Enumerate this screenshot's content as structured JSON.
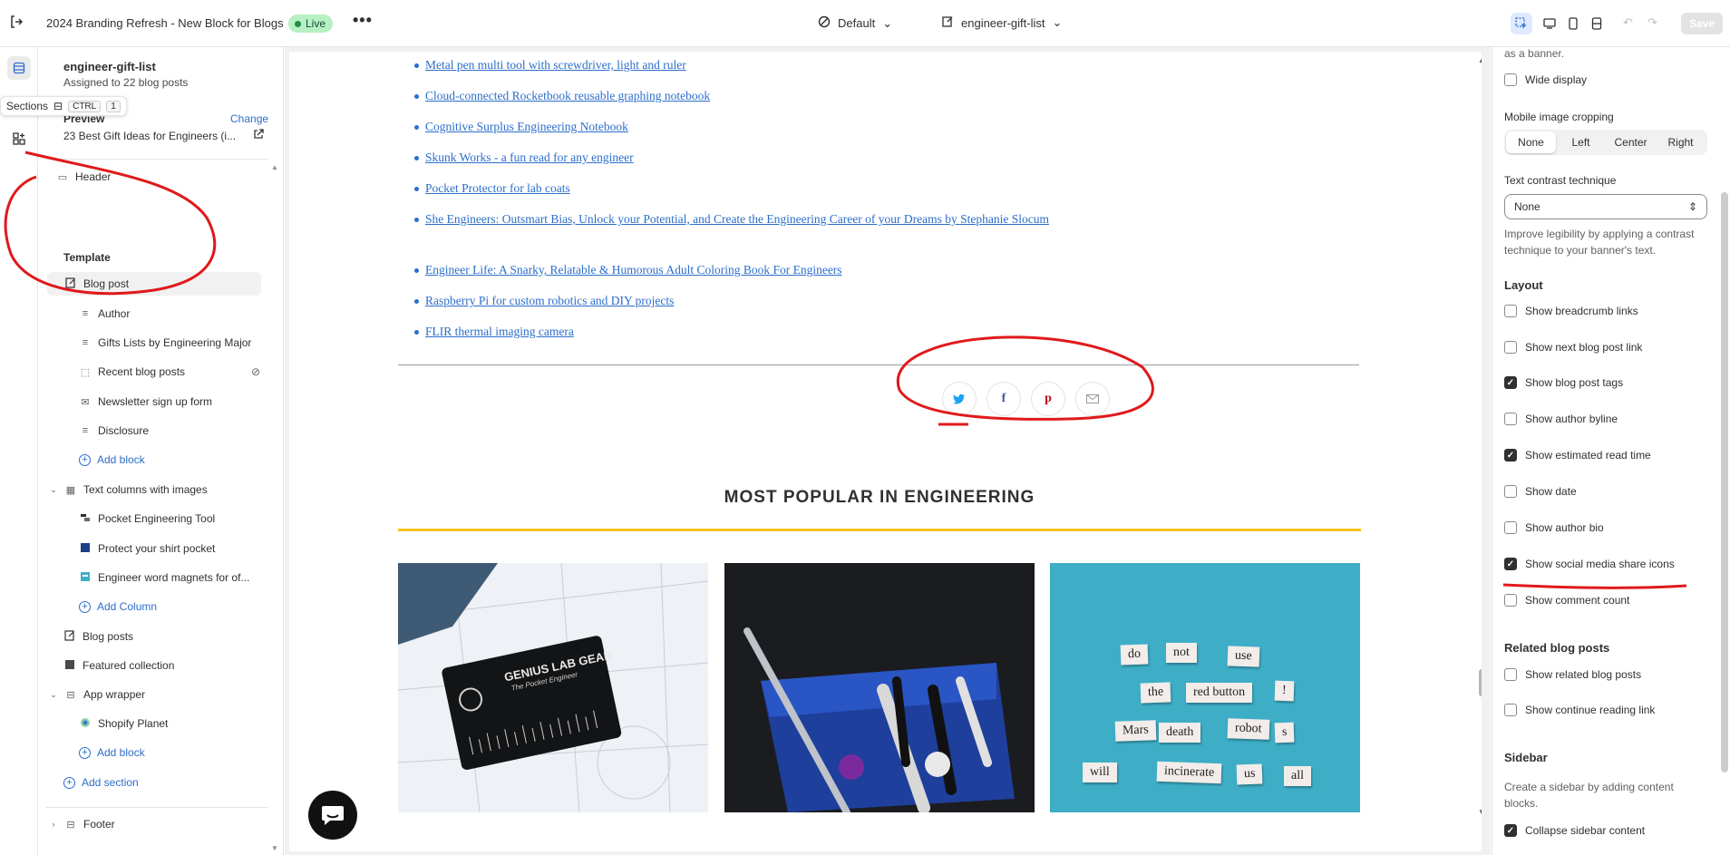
{
  "topbar": {
    "store_title": "2024 Branding Refresh - New Block for Blogs",
    "live_badge": "Live",
    "theme_label": "Default",
    "template_label": "engineer-gift-list",
    "save_label": "Save"
  },
  "rail": {
    "tooltip_label": "Sections",
    "tooltip_key_1": "CTRL",
    "tooltip_key_2": "1"
  },
  "left_panel": {
    "title": "engineer-gift-list",
    "subtitle": "Assigned to 22 blog posts",
    "preview_label": "Preview",
    "change_label": "Change",
    "preview_value": "23 Best Gift Ideas for Engineers (i...",
    "tree": {
      "header": "Header",
      "template_heading": "Template",
      "blog_post": "Blog post",
      "author": "Author",
      "gifts_lists": "Gifts Lists by Engineering Major",
      "recent_posts": "Recent blog posts",
      "newsletter": "Newsletter sign up form",
      "disclosure": "Disclosure",
      "add_block_1": "Add block",
      "text_columns": "Text columns with images",
      "pocket_tool": "Pocket Engineering Tool",
      "protect_shirt": "Protect your shirt pocket",
      "word_magnets": "Engineer word magnets for of...",
      "add_column": "Add Column",
      "blog_posts": "Blog posts",
      "featured": "Featured collection",
      "app_wrapper": "App wrapper",
      "shopify_planet": "Shopify Planet",
      "add_block_2": "Add block",
      "add_section": "Add section",
      "footer": "Footer"
    }
  },
  "canvas": {
    "links": [
      "Metal pen multi tool with screwdriver, light and ruler",
      "Cloud-connected Rocketbook reusable graphing notebook",
      "Cognitive Surplus Engineering Notebook",
      "Skunk Works - a fun read for any engineer",
      "Pocket Protector for lab coats",
      "She Engineers: Outsmart Bias, Unlock your Potential, and Create the Engineering Career of your Dreams by Stephanie Slocum",
      "Engineer Life: A Snarky, Relatable & Humorous Adult Coloring Book For Engineers",
      "Raspberry Pi for custom robotics and DIY projects",
      "FLIR thermal imaging camera"
    ],
    "popular_title": "MOST POPULAR IN ENGINEERING",
    "card1_brand": "GENIUS LAB GEAR",
    "card1_tagline": "The Pocket Engineer",
    "magnet_words": [
      "do",
      "not",
      "use",
      "the",
      "red button",
      "!",
      "Mars",
      "death",
      "robot",
      "s",
      "will",
      "incinerate",
      "us",
      "all"
    ]
  },
  "right_panel": {
    "banner_tail": "as a banner.",
    "wide_display": "Wide display",
    "mobile_crop_label": "Mobile image cropping",
    "crop_options": [
      "None",
      "Left",
      "Center",
      "Right"
    ],
    "contrast_label": "Text contrast technique",
    "contrast_value": "None",
    "contrast_help": "Improve legibility by applying a contrast technique to your banner's text.",
    "layout_heading": "Layout",
    "layout_options": [
      {
        "label": "Show breadcrumb links",
        "checked": false
      },
      {
        "label": "Show next blog post link",
        "checked": false
      },
      {
        "label": "Show blog post tags",
        "checked": true
      },
      {
        "label": "Show author byline",
        "checked": false
      },
      {
        "label": "Show estimated read time",
        "checked": true
      },
      {
        "label": "Show date",
        "checked": false
      },
      {
        "label": "Show author bio",
        "checked": false
      },
      {
        "label": "Show social media share icons",
        "checked": true
      },
      {
        "label": "Show comment count",
        "checked": false
      }
    ],
    "related_heading": "Related blog posts",
    "related_options": [
      {
        "label": "Show related blog posts",
        "checked": false
      },
      {
        "label": "Show continue reading link",
        "checked": false
      }
    ],
    "sidebar_heading": "Sidebar",
    "sidebar_help": "Create a sidebar by adding content blocks.",
    "collapse_sidebar": "Collapse sidebar content"
  },
  "colors": {
    "accent_blue": "#2c6ecb",
    "live_green": "#b7f0c3",
    "annotation_red": "#e0191b",
    "popular_underline": "#f5c41a"
  }
}
